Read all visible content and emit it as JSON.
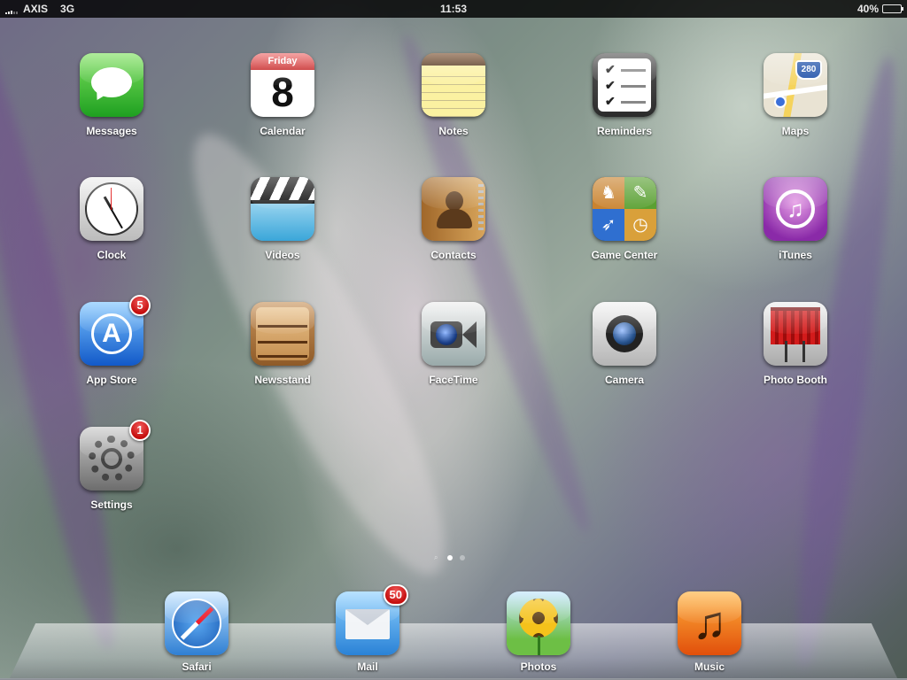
{
  "status_bar": {
    "carrier": "AXIS",
    "network": "3G",
    "time": "11:53",
    "battery": "40%",
    "battery_level": 0.4
  },
  "apps": [
    {
      "id": "messages",
      "label": "Messages",
      "icon": "speech-bubble-icon"
    },
    {
      "id": "calendar",
      "label": "Calendar",
      "icon": "calendar-icon",
      "day_name": "Friday",
      "day_number": "8"
    },
    {
      "id": "notes",
      "label": "Notes",
      "icon": "notepad-icon"
    },
    {
      "id": "reminders",
      "label": "Reminders",
      "icon": "checklist-icon"
    },
    {
      "id": "maps",
      "label": "Maps",
      "icon": "map-icon",
      "shield_text": "280"
    },
    {
      "id": "clock",
      "label": "Clock",
      "icon": "clock-icon"
    },
    {
      "id": "videos",
      "label": "Videos",
      "icon": "clapperboard-icon"
    },
    {
      "id": "contacts",
      "label": "Contacts",
      "icon": "address-book-icon"
    },
    {
      "id": "game_center",
      "label": "Game Center",
      "icon": "game-center-icon"
    },
    {
      "id": "itunes",
      "label": "iTunes",
      "icon": "music-note-circle-icon"
    },
    {
      "id": "app_store",
      "label": "App Store",
      "icon": "app-store-icon",
      "badge": "5"
    },
    {
      "id": "newsstand",
      "label": "Newsstand",
      "icon": "bookshelf-icon"
    },
    {
      "id": "facetime",
      "label": "FaceTime",
      "icon": "video-camera-icon"
    },
    {
      "id": "camera",
      "label": "Camera",
      "icon": "camera-lens-icon"
    },
    {
      "id": "photo_booth",
      "label": "Photo Booth",
      "icon": "curtain-booth-icon"
    },
    {
      "id": "settings",
      "label": "Settings",
      "icon": "gear-icon",
      "badge": "1"
    }
  ],
  "dock": [
    {
      "id": "safari",
      "label": "Safari",
      "icon": "compass-icon"
    },
    {
      "id": "mail",
      "label": "Mail",
      "icon": "envelope-icon",
      "badge": "50"
    },
    {
      "id": "photos",
      "label": "Photos",
      "icon": "sunflower-icon"
    },
    {
      "id": "music",
      "label": "Music",
      "icon": "music-note-icon"
    }
  ],
  "page_indicator": {
    "pages": 2,
    "current": 1
  }
}
